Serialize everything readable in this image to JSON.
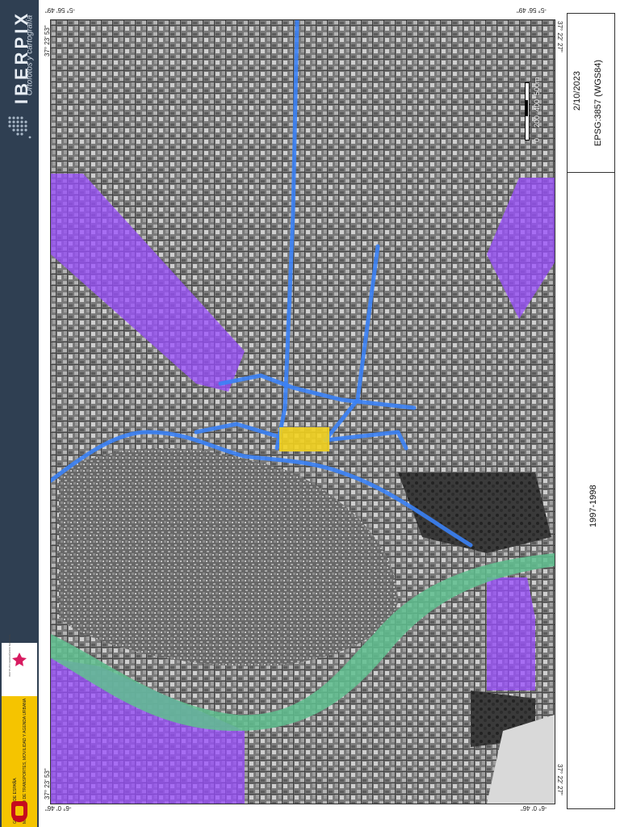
{
  "branding": {
    "title": "IBERPIX",
    "subtitle": "Ortofotos y cartografía",
    "ministry": "MINISTERIO DE TRANSPORTES, MOVILIDAD Y AGENDA URBANA",
    "government": "GOBIERNO DE ESPAÑA",
    "institute": "INSTITUTO GEOGRÁFICO NACIONAL",
    "logo_suffix": "cnig"
  },
  "map": {
    "period": "1997-1998",
    "date": "2/10/2023",
    "projection": "EPSG:3857 (WGS84)",
    "scale_labels": [
      "0",
      "200",
      "400",
      "500m"
    ],
    "coords": {
      "top_left_lon": "-5° 56' 49\"",
      "top_right_lon": "-5° 56' 49\"",
      "top_left_lat": "37° 23' 53\"",
      "top_right_lat": "37° 22' 27\"",
      "bottom_left_lon": "-6° 0' 46\"",
      "bottom_right_lon": "-6° 0' 46\"",
      "bottom_left_lat": "37° 23' 53\"",
      "bottom_right_lat": "37° 22' 27\""
    },
    "colors": {
      "river": "#5fbf8f",
      "zones": "#9a4dff",
      "routes": "#3b82f6",
      "highlight": "#f2d11f"
    }
  }
}
